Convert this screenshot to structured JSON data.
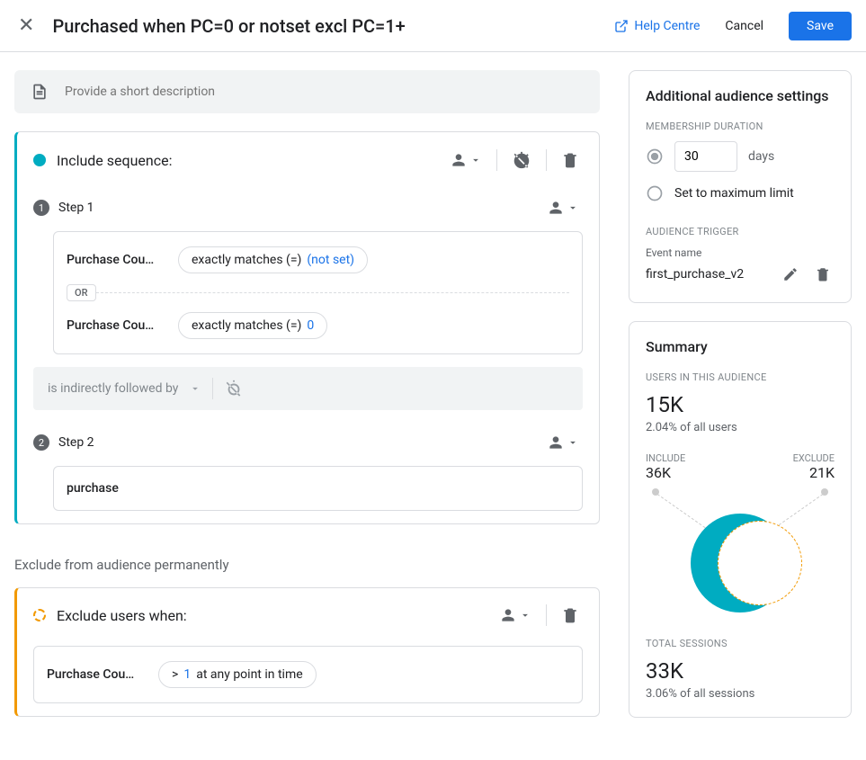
{
  "header": {
    "title": "Purchased when PC=0 or notset excl PC=1+",
    "help": "Help Centre",
    "cancel": "Cancel",
    "save": "Save"
  },
  "description_placeholder": "Provide a short description",
  "include": {
    "title": "Include sequence:",
    "step1": {
      "label": "Step 1",
      "cond1": {
        "field": "Purchase Cou…",
        "op": "exactly matches (=)",
        "value": "(not set)"
      },
      "or": "OR",
      "cond2": {
        "field": "Purchase Cou…",
        "op": "exactly matches (=)",
        "value": "0"
      }
    },
    "followed_by": "is indirectly followed by",
    "step2": {
      "label": "Step 2",
      "event": "purchase"
    }
  },
  "exclude_section_title": "Exclude from audience permanently",
  "exclude": {
    "title": "Exclude users when:",
    "cond": {
      "field": "Purchase Cou…",
      "text_prefix": "> ",
      "value": "1",
      "text_suffix": " at any point in time"
    }
  },
  "settings": {
    "title": "Additional audience settings",
    "duration_label": "MEMBERSHIP DURATION",
    "duration_value": "30",
    "days": "days",
    "max_limit": "Set to maximum limit",
    "trigger_label": "AUDIENCE TRIGGER",
    "event_name_label": "Event name",
    "event_name": "first_purchase_v2"
  },
  "summary": {
    "title": "Summary",
    "users_label": "USERS IN THIS AUDIENCE",
    "users_value": "15K",
    "users_pct": "2.04% of all users",
    "include_label": "INCLUDE",
    "include_value": "36K",
    "exclude_label": "EXCLUDE",
    "exclude_value": "21K",
    "sessions_label": "TOTAL SESSIONS",
    "sessions_value": "33K",
    "sessions_pct": "3.06% of all sessions"
  }
}
